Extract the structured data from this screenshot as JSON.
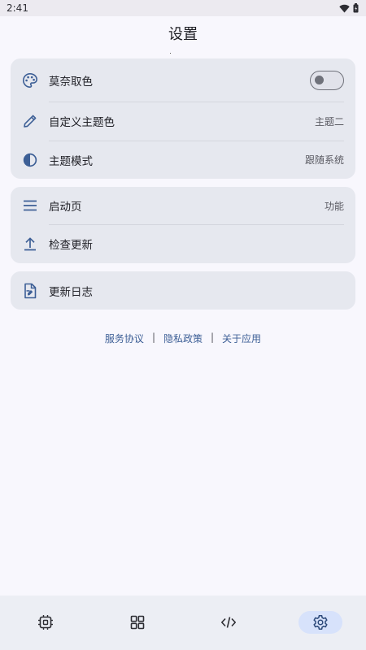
{
  "status_bar": {
    "time": "2:41"
  },
  "header": {
    "title": "设置"
  },
  "appearance_card": {
    "monet": {
      "label": "莫奈取色",
      "icon": "palette-icon",
      "toggle_on": false
    },
    "custom_theme_color": {
      "label": "自定义主题色",
      "value": "主题二",
      "icon": "pencil-icon"
    },
    "theme_mode": {
      "label": "主题模式",
      "value": "跟随系统",
      "icon": "half-circle-icon"
    }
  },
  "general_card": {
    "start_page": {
      "label": "启动页",
      "value": "功能",
      "icon": "menu-lines-icon"
    },
    "check_update": {
      "label": "检查更新",
      "icon": "upload-icon"
    }
  },
  "changelog_card": {
    "changelog": {
      "label": "更新日志",
      "icon": "document-icon"
    }
  },
  "links": {
    "terms": "服务协议",
    "privacy": "隐私政策",
    "about": "关于应用",
    "separator": "|"
  },
  "bottom_nav": {
    "items": [
      {
        "icon": "chip-icon",
        "active": false
      },
      {
        "icon": "grid-icon",
        "active": false
      },
      {
        "icon": "code-icon",
        "active": false
      },
      {
        "icon": "gear-icon",
        "active": true
      }
    ]
  },
  "colors": {
    "accent": "#3d5f96",
    "background": "#f8f7fd",
    "card": "#e6e8ef",
    "nav_active": "#d7e2fb"
  }
}
